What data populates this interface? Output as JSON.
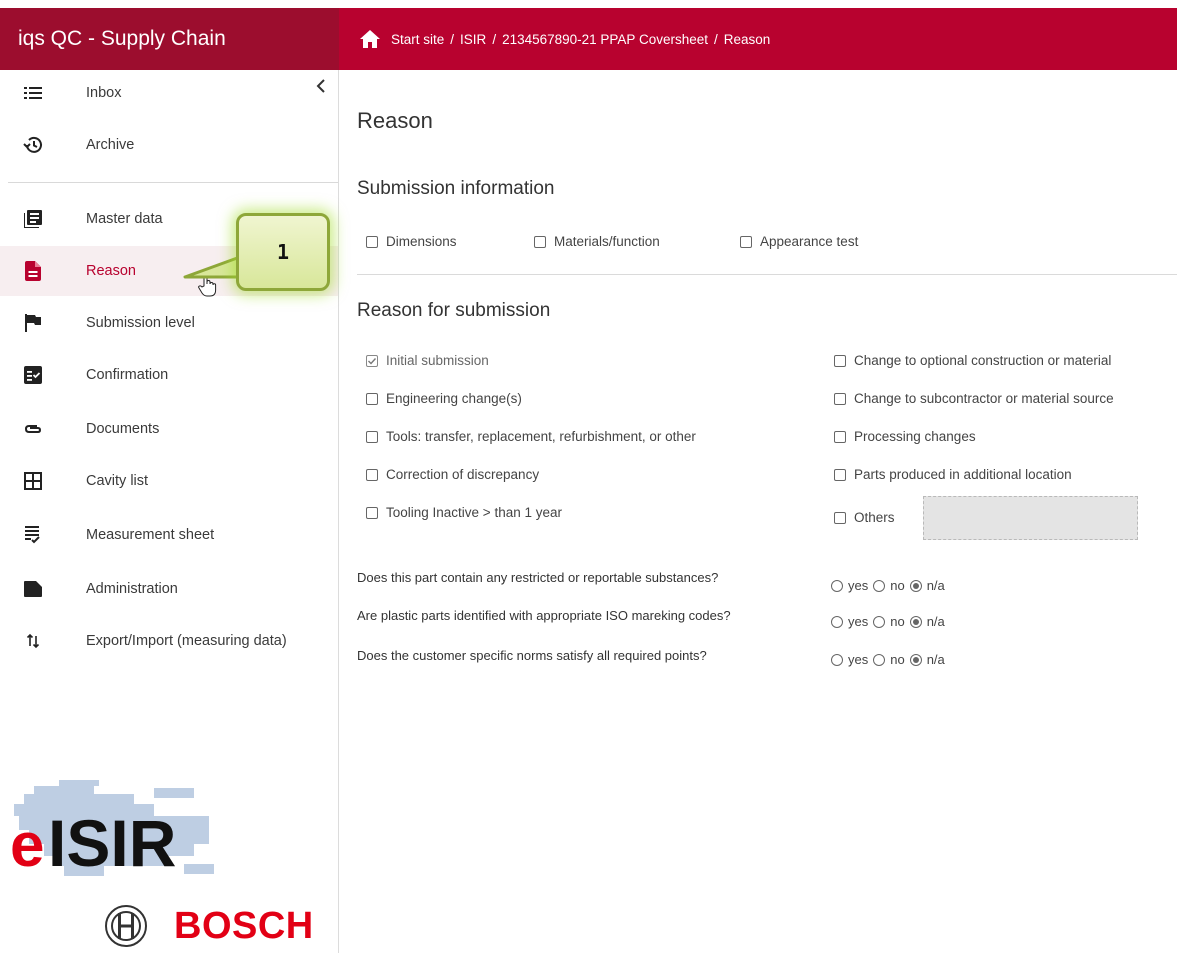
{
  "app": {
    "title": "iqs QC - Supply Chain"
  },
  "breadcrumb": [
    "Start site",
    "ISIR",
    "2134567890-21 PPAP Coversheet",
    "Reason"
  ],
  "sidebar": {
    "items": [
      {
        "label": "Inbox",
        "icon": "list-icon"
      },
      {
        "label": "Archive",
        "icon": "history-icon"
      },
      {
        "label": "Master data",
        "icon": "book-icon"
      },
      {
        "label": "Reason",
        "icon": "document-icon",
        "active": true
      },
      {
        "label": "Submission level",
        "icon": "flag-icon"
      },
      {
        "label": "Confirmation",
        "icon": "fact-check-icon"
      },
      {
        "label": "Documents",
        "icon": "attachment-icon"
      },
      {
        "label": "Cavity list",
        "icon": "grid-icon"
      },
      {
        "label": "Measurement sheet",
        "icon": "checklist-icon"
      },
      {
        "label": "Administration",
        "icon": "folder-icon"
      },
      {
        "label": "Export/Import (measuring data)",
        "icon": "sort-arrows-icon"
      }
    ]
  },
  "callout": {
    "number": "1"
  },
  "logos": {
    "eisir": "eISIR",
    "bosch": "BOSCH"
  },
  "main": {
    "title": "Reason",
    "submission_info": {
      "heading": "Submission information",
      "options": [
        {
          "label": "Dimensions",
          "checked": false
        },
        {
          "label": "Materials/function",
          "checked": false
        },
        {
          "label": "Appearance test",
          "checked": false
        }
      ]
    },
    "reason": {
      "heading": "Reason for submission",
      "left": [
        {
          "label": "Initial submission",
          "checked": true,
          "disabled": true
        },
        {
          "label": "Engineering change(s)",
          "checked": false
        },
        {
          "label": "Tools: transfer, replacement, refurbishment, or other",
          "checked": false
        },
        {
          "label": "Correction of discrepancy",
          "checked": false
        },
        {
          "label": "Tooling Inactive > than 1 year",
          "checked": false
        }
      ],
      "right": [
        {
          "label": "Change to optional construction or material",
          "checked": false
        },
        {
          "label": "Change to subcontractor or material source",
          "checked": false
        },
        {
          "label": "Processing changes",
          "checked": false
        },
        {
          "label": "Parts produced in additional location",
          "checked": false
        },
        {
          "label": "Others",
          "checked": false
        }
      ],
      "others_value": ""
    },
    "questions": [
      {
        "text": "Does this part contain any restricted or reportable substances?",
        "selected": "n/a"
      },
      {
        "text": "Are plastic parts identified with appropriate ISO mareking codes?",
        "selected": "n/a"
      },
      {
        "text": "Does the customer specific norms satisfy all required points?",
        "selected": "n/a"
      }
    ],
    "radio_options": [
      "yes",
      "no",
      "n/a"
    ]
  },
  "colors": {
    "brand": "#b8022f",
    "brand_dark": "#9c0d2e",
    "bosch_red": "#e20015",
    "callout_green": "#8ea739"
  }
}
